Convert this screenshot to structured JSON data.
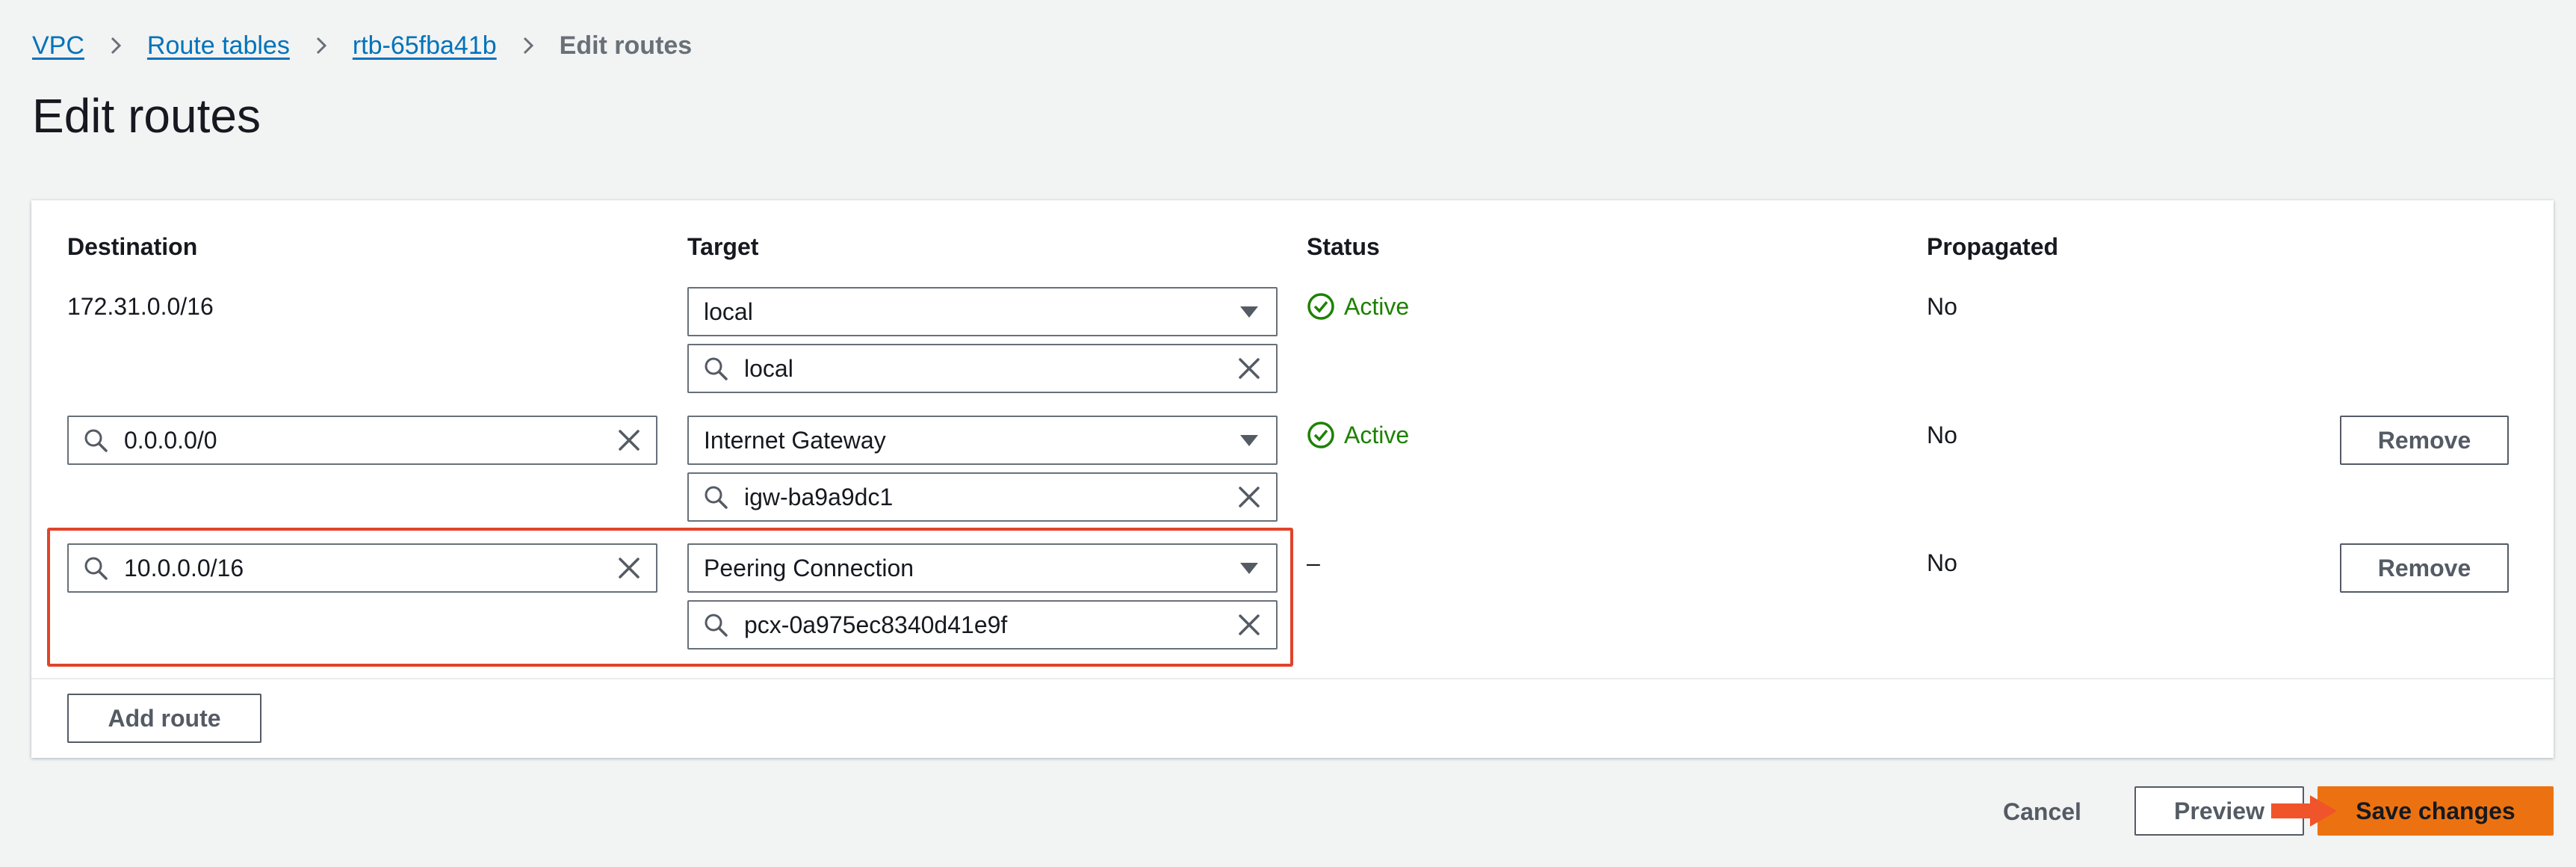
{
  "breadcrumb": {
    "vpc": "VPC",
    "route_tables": "Route tables",
    "route_table_id": "rtb-65fba41b",
    "current": "Edit routes"
  },
  "page_title": "Edit routes",
  "columns": {
    "destination": "Destination",
    "target": "Target",
    "status": "Status",
    "propagated": "Propagated"
  },
  "routes": [
    {
      "destination": "172.31.0.0/16",
      "target_type": "local",
      "target_value": "local",
      "status": "Active",
      "propagated": "No"
    },
    {
      "destination": "0.0.0.0/0",
      "target_type": "Internet Gateway",
      "target_value": "igw-ba9a9dc1",
      "status": "Active",
      "propagated": "No",
      "remove_label": "Remove"
    },
    {
      "destination": "10.0.0.0/16",
      "target_type": "Peering Connection",
      "target_value": "pcx-0a975ec8340d41e9f",
      "status": "–",
      "propagated": "No",
      "remove_label": "Remove"
    }
  ],
  "add_route_label": "Add route",
  "footer": {
    "cancel_label": "Cancel",
    "preview_label": "Preview",
    "save_label": "Save changes"
  },
  "colors": {
    "link": "#0073bb",
    "status_active": "#1d8102",
    "primary_button": "#ec7211",
    "highlight_border": "#e0442b"
  },
  "icons": [
    "chevron-right-icon",
    "search-icon",
    "clear-icon",
    "caret-down-icon",
    "check-circle-icon",
    "arrow-right-icon"
  ]
}
